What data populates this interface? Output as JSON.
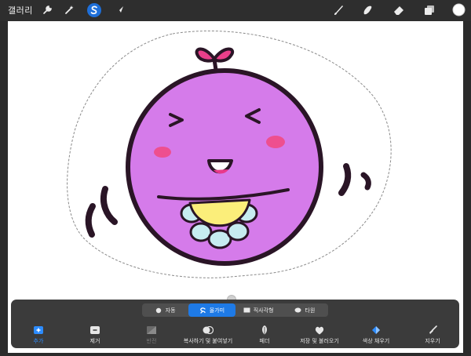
{
  "topbar": {
    "gallery_label": "갤러리",
    "left_tools": [
      "wrench-icon",
      "magic-wand-icon",
      "selection-icon",
      "transform-icon"
    ],
    "active_tool": "selection-icon",
    "right_tools": [
      "brush-icon",
      "smudge-icon",
      "eraser-icon",
      "layers-icon",
      "color-swatch-icon"
    ],
    "color_swatch": "#ffffff"
  },
  "selection_modes": {
    "items": [
      {
        "label": "자동",
        "icon": "auto-dot-icon"
      },
      {
        "label": "올가미",
        "icon": "lasso-icon"
      },
      {
        "label": "직사각형",
        "icon": "rectangle-icon"
      },
      {
        "label": "타원",
        "icon": "ellipse-icon"
      }
    ],
    "active": "올가미"
  },
  "actions": {
    "items": [
      {
        "label": "추가",
        "icon": "add-selection-icon",
        "state": "active"
      },
      {
        "label": "제거",
        "icon": "remove-selection-icon",
        "state": "normal"
      },
      {
        "label": "반전",
        "icon": "invert-icon",
        "state": "disabled"
      },
      {
        "label": "복사하기 및 붙여넣기",
        "icon": "copy-paste-icon",
        "state": "normal"
      },
      {
        "label": "페더",
        "icon": "feather-icon",
        "state": "normal"
      },
      {
        "label": "저장 및 불러오기",
        "icon": "save-load-heart-icon",
        "state": "normal"
      },
      {
        "label": "색상 채우기",
        "icon": "color-fill-icon",
        "state": "normal"
      },
      {
        "label": "지우기",
        "icon": "clear-broom-icon",
        "state": "normal"
      }
    ]
  },
  "colors": {
    "accent_blue": "#1e7ae6",
    "character_body": "#d57bea",
    "character_outline": "#2a1526",
    "heart": "#ea3f8a",
    "cheek": "#ee4f8f",
    "bib_yellow": "#fbee7a",
    "bib_petals": "#c7ecf0"
  }
}
